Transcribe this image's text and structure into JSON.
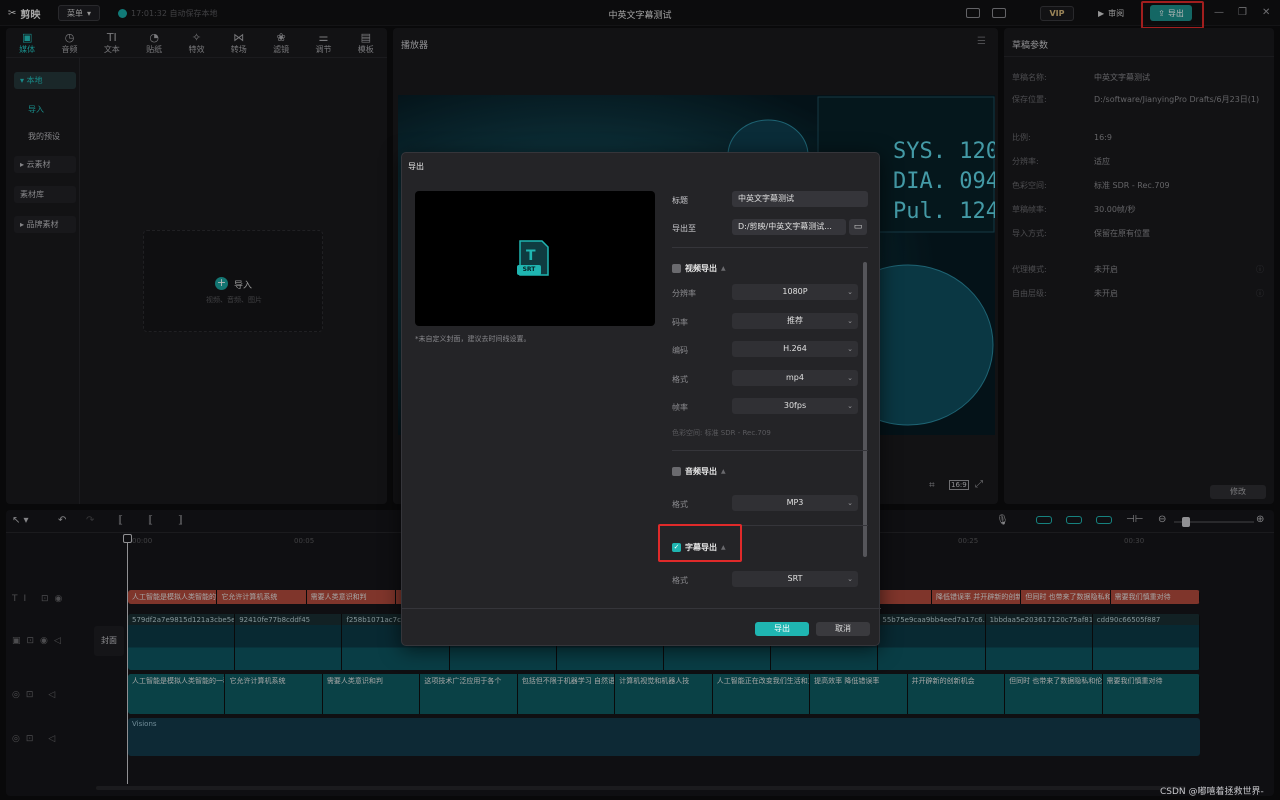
{
  "app": {
    "name": "剪映",
    "menu": "菜单",
    "autosave": "17:01:32 自动保存本地",
    "title": "中英文字幕测试",
    "vip": "VIP",
    "review": "审阅",
    "export": "导出"
  },
  "media_tabs": [
    {
      "icon": "▣",
      "label": "媒体"
    },
    {
      "icon": "◷",
      "label": "音频"
    },
    {
      "icon": "TI",
      "label": "文本"
    },
    {
      "icon": "◔",
      "label": "贴纸"
    },
    {
      "icon": "✧",
      "label": "特效"
    },
    {
      "icon": "⋈",
      "label": "转场"
    },
    {
      "icon": "❀",
      "label": "滤镜"
    },
    {
      "icon": "⚌",
      "label": "调节"
    },
    {
      "icon": "▤",
      "label": "模板"
    }
  ],
  "sidebar": {
    "local": "▾ 本地",
    "import": "导入",
    "presets": "我的预设",
    "cloud": "▸ 云素材",
    "library": "素材库",
    "brand": "▸ 品牌素材"
  },
  "import_box": {
    "label": "导入",
    "hint": "视频、音频、图片"
  },
  "player": {
    "title": "播放器",
    "ratio": "16:9"
  },
  "params": {
    "title": "草稿参数",
    "rows": [
      {
        "k": "草稿名称:",
        "v": "中英文字幕测试"
      },
      {
        "k": "保存位置:",
        "v": "D:/software/JianyingPro Drafts/6月23日(1)"
      },
      {
        "k": "比例:",
        "v": "16:9"
      },
      {
        "k": "分辨率:",
        "v": "适应"
      },
      {
        "k": "色彩空间:",
        "v": "标准 SDR - Rec.709"
      },
      {
        "k": "草稿帧率:",
        "v": "30.00帧/秒"
      },
      {
        "k": "导入方式:",
        "v": "保留在原有位置"
      },
      {
        "k": "代理模式:",
        "v": "未开启"
      },
      {
        "k": "自由层级:",
        "v": "未开启"
      }
    ],
    "modify": "修改"
  },
  "timeline": {
    "ticks": [
      "00:00",
      "00:05",
      "00:25",
      "00:30"
    ],
    "cover": "封面",
    "audio_label": "Visions",
    "subs": [
      "人工智能是模拟人类智能的一种",
      "它允许计算机系统",
      "需要人类意识和判",
      "",
      "",
      "",
      "",
      "",
      "",
      "降低错误率 并开辟新的创新机会",
      "但同时 也带来了数据隐私和伦理问题",
      "需要我们慎重对待"
    ],
    "videos": [
      "579df2a7e9815d121a3cbe5e44",
      "92410fe77b8cddf45",
      "f258b1071ac7c99c",
      "",
      "",
      "",
      "",
      "55b75e9caa9bb4eed7a17c6.mp",
      "1bbdaa5e203617120c75af817acdb",
      "cdd90c66505f887"
    ],
    "tts": [
      "人工智能是模拟人类智能的一种",
      "它允许计算机系统",
      "需要人类意识和判",
      "这项技术广泛应用于各个",
      "包括但不限于机器学习 自然语言",
      "计算机视觉和机器人技",
      "人工智能正在改变我们生活和工作",
      "提高效率 降低错误率",
      "并开辟新的创新机会",
      "但同时 也带来了数据隐私和伦理问",
      "需要我们慎重对待"
    ]
  },
  "dialog": {
    "title": "导出",
    "title_label": "标题",
    "title_value": "中英文字幕测试",
    "export_to_label": "导出至",
    "export_to_value": "D:/剪映/中英文字幕测试...",
    "note": "*未自定义封面，建议去时间线设置。",
    "srt": "SRT",
    "video_section": "视频导出",
    "resolution_label": "分辨率",
    "resolution": "1080P",
    "bitrate_label": "码率",
    "bitrate": "推荐",
    "codec_label": "编码",
    "codec": "H.264",
    "format_label": "格式",
    "format": "mp4",
    "fps_label": "帧率",
    "fps": "30fps",
    "colorspace": "色彩空间:  标准 SDR - Rec.709",
    "audio_section": "音频导出",
    "audio_format_label": "格式",
    "audio_format": "MP3",
    "subtitle_section": "字幕导出",
    "sub_format_label": "格式",
    "sub_format": "SRT",
    "export_btn": "导出",
    "cancel_btn": "取消"
  },
  "watermark": "CSDN @嘟嘻着拯救世界-",
  "colors": {
    "accent": "#1fb5b1",
    "highlight": "#e02a2a",
    "sub_track": "#b04a3c",
    "tts_track": "#0f5b61"
  }
}
